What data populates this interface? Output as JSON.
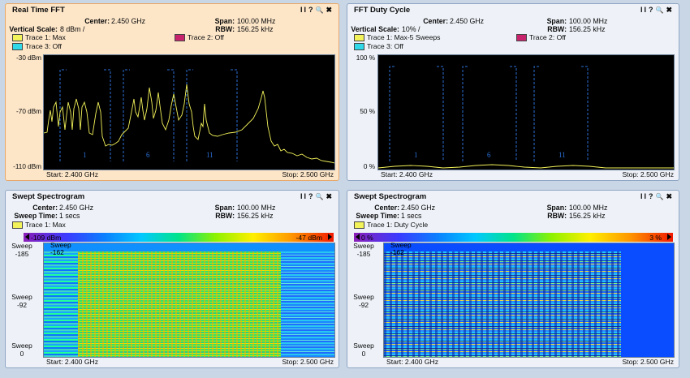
{
  "panels": {
    "rt_fft": {
      "title": "Real Time FFT",
      "center_label": "Center:",
      "center_value": "2.450 GHz",
      "span_label": "Span:",
      "span_value": "100.00 MHz",
      "scale_label": "Vertical Scale:",
      "scale_value": "8 dBm /",
      "rbw_label": "RBW:",
      "rbw_value": "156.25 kHz",
      "trace1": "Trace 1: Max",
      "trace2": "Trace 2: Off",
      "trace3": "Trace 3: Off",
      "y_top": "-30 dBm",
      "y_mid": "-70 dBm",
      "y_bot": "-110 dBm",
      "start": "Start: 2.400 GHz",
      "stop": "Stop: 2.500 GHz",
      "channels": [
        "1",
        "6",
        "11"
      ]
    },
    "duty": {
      "title": "FFT Duty Cycle",
      "center_label": "Center:",
      "center_value": "2.450 GHz",
      "span_label": "Span:",
      "span_value": "100.00 MHz",
      "scale_label": "Vertical Scale:",
      "scale_value": "10% /",
      "rbw_label": "RBW:",
      "rbw_value": "156.25 kHz",
      "trace1": "Trace 1: Max-5 Sweeps",
      "trace2": "Trace 2: Off",
      "trace3": "Trace 3: Off",
      "y_top": "100 %",
      "y_mid": "50 %",
      "y_bot": "0 %",
      "start": "Start: 2.400 GHz",
      "stop": "Stop: 2.500 GHz",
      "channels": [
        "1",
        "6",
        "11"
      ]
    },
    "spec1": {
      "title": "Swept Spectrogram",
      "center_label": "Center:",
      "center_value": "2.450 GHz",
      "span_label": "Span:",
      "span_value": "100.00 MHz",
      "sweep_label": "Sweep Time:",
      "sweep_value": "1 secs",
      "rbw_label": "RBW:",
      "rbw_value": "156.25 kHz",
      "trace1": "Trace 1: Max",
      "cbar_min": "-109 dBm",
      "cbar_max": "-47 dBm",
      "sweep_word": "Sweep",
      "sweep_top": "-185",
      "sweep_mid": "-92",
      "sweep_bot": "0",
      "sweep_cursor": "-162",
      "start": "Start: 2.400 GHz",
      "stop": "Stop: 2.500 GHz"
    },
    "spec2": {
      "title": "Swept Spectrogram",
      "center_label": "Center:",
      "center_value": "2.450 GHz",
      "span_label": "Span:",
      "span_value": "100.00 MHz",
      "sweep_label": "Sweep Time:",
      "sweep_value": "1 secs",
      "rbw_label": "RBW:",
      "rbw_value": "156.25 kHz",
      "trace1": "Trace 1: Duty Cycle",
      "cbar_min": "0 %",
      "cbar_max": "3 %",
      "sweep_word": "Sweep",
      "sweep_top": "-185",
      "sweep_mid": "-92",
      "sweep_bot": "0",
      "sweep_cursor": "-162",
      "start": "Start: 2.400 GHz",
      "stop": "Stop: 2.500 GHz"
    }
  },
  "controls": {
    "pause": "II",
    "help": "?",
    "zoom": "🔍",
    "close": "✖"
  },
  "colors": {
    "trace1": "#f2f25a",
    "trace2": "#c8246e",
    "trace3": "#30d8e8",
    "mask": "#2b6fd6",
    "active_panel": "#fde6c8"
  }
}
